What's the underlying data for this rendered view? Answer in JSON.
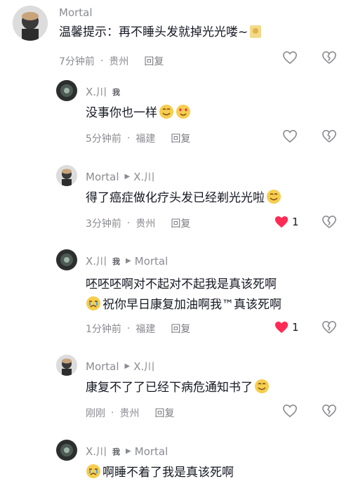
{
  "comments": [
    {
      "author": "Mortal",
      "text": "温馨提示：再不睡头发就掉光光喽~",
      "time": "7分钟前",
      "location": "贵州",
      "reply_label": "回复",
      "likes": "",
      "liked": false
    },
    {
      "author": "X.川",
      "me_tag": "我",
      "text": "没事你也一样",
      "time": "5分钟前",
      "location": "福建",
      "reply_label": "回复",
      "likes": "",
      "liked": false
    },
    {
      "author": "Mortal",
      "reply_to": "X.川",
      "text": "得了癌症做化疗头发已经剃光光啦",
      "time": "3分钟前",
      "location": "贵州",
      "reply_label": "回复",
      "likes": "1",
      "liked": true
    },
    {
      "author": "X.川",
      "me_tag": "我",
      "reply_to": "Mortal",
      "text_line1": "呸呸呸啊对不起对不起我是真该死啊",
      "text_line2": "祝你早日康复加油啊我™真该死啊",
      "time": "1分钟前",
      "location": "福建",
      "reply_label": "回复",
      "likes": "1",
      "liked": true
    },
    {
      "author": "Mortal",
      "reply_to": "X.川",
      "text": "康复不了了已经下病危通知书了",
      "time": "刚刚",
      "location": "贵州",
      "reply_label": "回复",
      "likes": "",
      "liked": false
    },
    {
      "author": "X.川",
      "me_tag": "我",
      "reply_to": "Mortal",
      "text": "啊睡不着了我是真该死啊"
    }
  ],
  "colors": {
    "liked_heart": "#fe2c55",
    "muted_text": "#8a8b91"
  }
}
